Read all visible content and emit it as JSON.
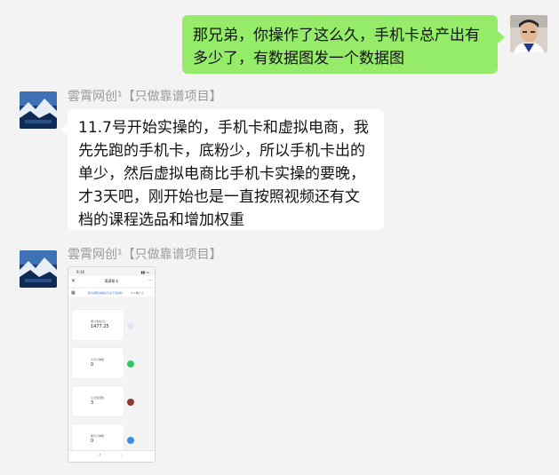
{
  "messages": {
    "outgoing": {
      "text_line1": "那兄弟，你操作了这么久，手机卡总产出有",
      "text_line2": "多少了，有数据图发一个数据图"
    },
    "incoming_text": {
      "sender": "雲霄网创¹【只做靠谱项目】",
      "lines": [
        "11.7号开始实操的，手机卡和虚拟电商，我",
        "先先跑的手机卡，底粉少，所以手机卡出的",
        "单少，然后虚拟电商比手机卡实操的要晚，",
        "才3天吧，刚开始也是一直按照视频还有文",
        "档的课程选品和增加权重"
      ]
    },
    "incoming_image": {
      "sender": "雲霄网创¹【只做靠谱项目】",
      "screenshot": {
        "status_time": "9:16",
        "status_signal": "▮▮ ▭",
        "app_title": "滴滴帮卡",
        "app_subtitle": "··· ···",
        "close_icon": "✕",
        "more_icon": "···",
        "grid_icon": "▦",
        "marquee_text": "官方通知请前往平台下载资料",
        "marquee_value": "0.3  推广人",
        "cards": [
          {
            "label": "累计收益(元)",
            "value": "1477.25",
            "icon": "user-icon",
            "color": "#dfe7f5"
          },
          {
            "label": "今日订单数",
            "value": "0",
            "icon": "check-icon",
            "color": "#35c86a"
          },
          {
            "label": "今日激活数",
            "value": "3",
            "icon": "activate-icon",
            "color": "#8a3b2e"
          },
          {
            "label": "累计订单数",
            "value": "0",
            "icon": "send-icon",
            "color": "#3a8ee6"
          }
        ],
        "nav_back": "‹",
        "nav_forward": "›"
      }
    }
  }
}
